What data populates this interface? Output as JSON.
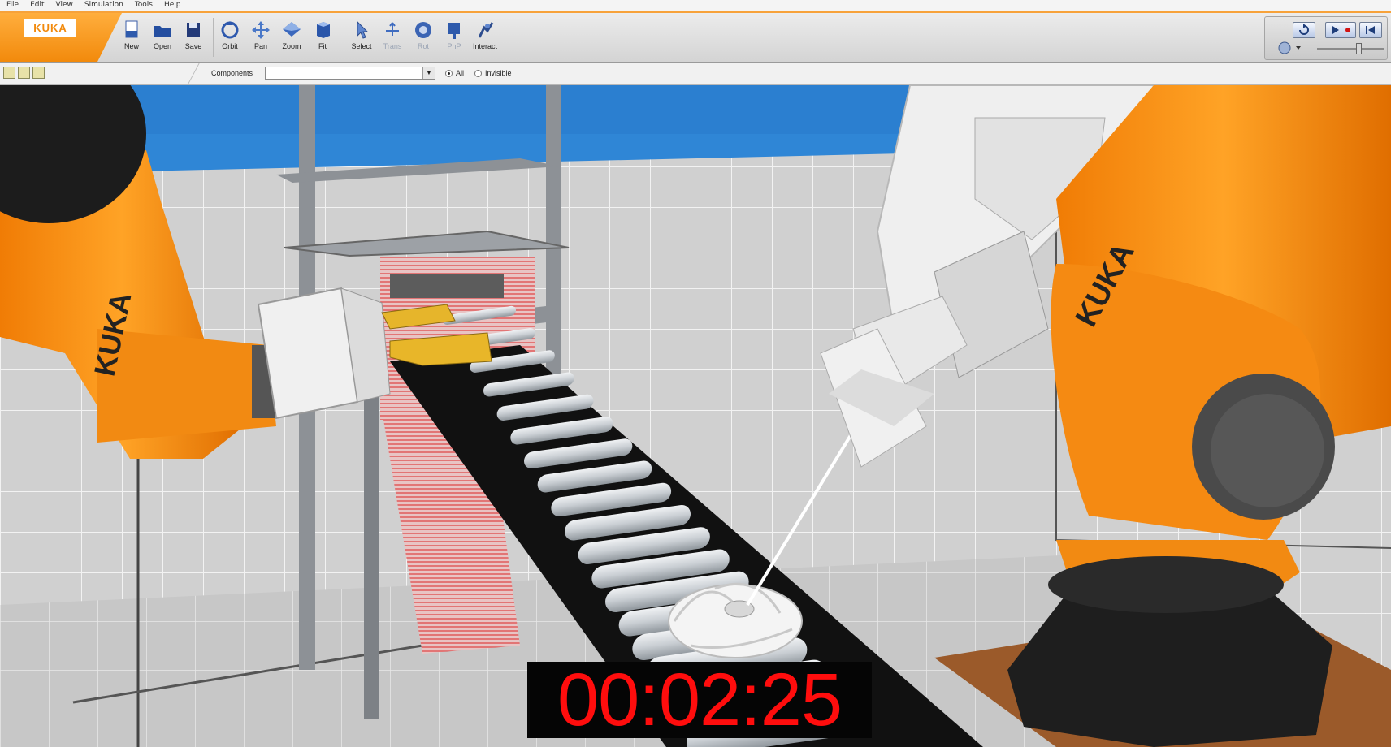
{
  "app": {
    "brand": "KUKA",
    "menu": [
      "File",
      "Edit",
      "View",
      "Simulation",
      "Tools",
      "Help"
    ]
  },
  "toolbar": {
    "file_buttons": [
      {
        "label": "New",
        "icon": "new-document-icon"
      },
      {
        "label": "Open",
        "icon": "open-folder-icon"
      },
      {
        "label": "Save",
        "icon": "save-disk-icon"
      }
    ],
    "view_buttons": [
      {
        "label": "Orbit",
        "icon": "orbit-icon"
      },
      {
        "label": "Pan",
        "icon": "pan-arrows-icon"
      },
      {
        "label": "Zoom",
        "icon": "zoom-icon"
      },
      {
        "label": "Fit",
        "icon": "fit-icon"
      }
    ],
    "tool_buttons": [
      {
        "label": "Select",
        "icon": "select-cursor-icon",
        "enabled": true
      },
      {
        "label": "Trans",
        "icon": "translate-icon",
        "enabled": false
      },
      {
        "label": "Rot",
        "icon": "rotate-icon",
        "enabled": false
      },
      {
        "label": "PnP",
        "icon": "pick-and-place-icon",
        "enabled": false
      },
      {
        "label": "Interact",
        "icon": "interact-icon",
        "enabled": true
      }
    ]
  },
  "components_bar": {
    "label": "Components",
    "selected": "",
    "filter_options": [
      {
        "label": "All",
        "checked": true
      },
      {
        "label": "Invisible",
        "checked": false
      }
    ]
  },
  "scene": {
    "robot_left_label": "KUKA",
    "robot_right_label": "KUKA"
  },
  "timer": {
    "value": "00:02:25"
  },
  "colors": {
    "brand_orange": "#f28a0c",
    "robot_orange": "#f58a12",
    "timer_red": "#ff0d0d"
  }
}
